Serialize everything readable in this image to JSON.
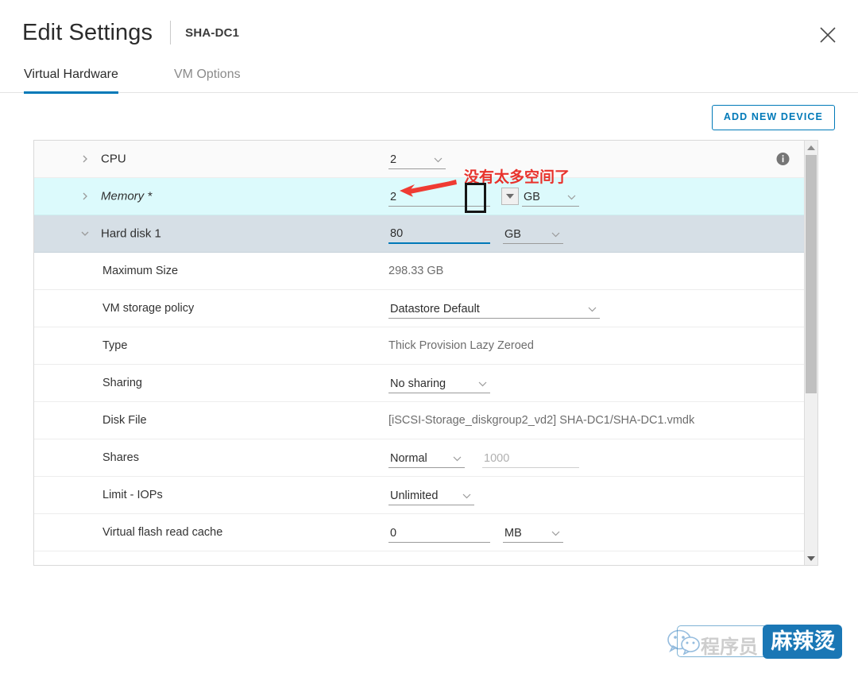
{
  "header": {
    "title": "Edit Settings",
    "vm_name": "SHA-DC1",
    "close_label": "Close"
  },
  "tabs": [
    {
      "label": "Virtual Hardware",
      "active": true
    },
    {
      "label": "VM Options",
      "active": false
    }
  ],
  "toolbar": {
    "add_new_device_label": "ADD NEW DEVICE"
  },
  "rows": {
    "cpu": {
      "label": "CPU",
      "value": "2",
      "info_icon_title": "info-icon"
    },
    "memory": {
      "label": "Memory *",
      "value": "2",
      "unit": "GB"
    },
    "hard_disk": {
      "label": "Hard disk 1",
      "value": "80",
      "unit": "GB"
    },
    "maximum_size": {
      "label": "Maximum Size",
      "value": "298.33 GB"
    },
    "vm_storage_policy": {
      "label": "VM storage policy",
      "value": "Datastore Default"
    },
    "type": {
      "label": "Type",
      "value": "Thick Provision Lazy Zeroed"
    },
    "sharing": {
      "label": "Sharing",
      "value": "No sharing"
    },
    "disk_file": {
      "label": "Disk File",
      "value": "[iSCSI-Storage_diskgroup2_vd2] SHA-DC1/SHA-DC1.vmdk"
    },
    "shares": {
      "label": "Shares",
      "value": "Normal",
      "amount": "1000"
    },
    "limit_iops": {
      "label": "Limit - IOPs",
      "value": "Unlimited"
    },
    "virtual_flash_read_cache": {
      "label": "Virtual flash read cache",
      "value": "0",
      "unit": "MB"
    }
  },
  "annotations": {
    "note_text": "没有太多空间了",
    "note_color": "#e8322c",
    "highlight_box_color": "#161616",
    "arrow_color": "#ef3b33"
  },
  "watermark": {
    "faint_text": "程序员",
    "badge_text": "麻辣烫",
    "badge_color": "#1a77b5",
    "outline_color": "#7fb3d5"
  },
  "scrollbar": {
    "up_label": "scroll up",
    "down_label": "scroll down"
  }
}
